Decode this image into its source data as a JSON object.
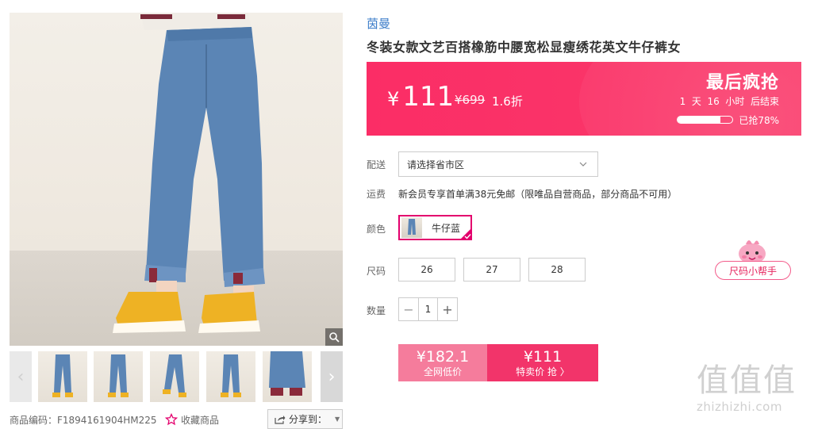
{
  "gallery": {
    "main_image_alt": "",
    "thumbnail_count": 5
  },
  "product_meta": {
    "code_label": "商品编码：F1894161904HM225",
    "favorite_label": "收藏商品",
    "share_label": "分享到："
  },
  "product": {
    "brand": "茵曼",
    "title": "冬装女款文艺百搭橡筋中腰宽松显瘦绣花英文牛仔裤女"
  },
  "price_banner": {
    "currency": "¥",
    "sale_price": "111",
    "original_price": "¥699",
    "discount": "1.6折",
    "flash_title": "最后疯抢",
    "countdown": "1  天  16  小时  后结束",
    "sold_percent": 78,
    "sold_text": "已抢78%"
  },
  "delivery": {
    "label": "配送",
    "placeholder": "请选择省市区"
  },
  "shipping": {
    "label": "运费",
    "text": "新会员专享首单满38元免邮（限唯品自营商品，部分商品不可用）"
  },
  "color": {
    "label": "颜色",
    "selected": "牛仔蓝"
  },
  "size": {
    "label": "尺码",
    "options": [
      "26",
      "27",
      "28"
    ],
    "helper_label": "尺码小帮手"
  },
  "quantity": {
    "label": "数量",
    "minus": "−",
    "value": "1",
    "plus": "+"
  },
  "buy": {
    "market_price": "¥182.1",
    "market_label": "全网低价",
    "sale_price": "¥111",
    "sale_label": "特卖价 抢 〉"
  },
  "watermark": {
    "chars": "值值值",
    "domain": "zhizhizhi.com"
  },
  "colors": {
    "accent": "#f93a6a",
    "brand_link": "#3b7cc9",
    "selected_border": "#e3006d"
  }
}
